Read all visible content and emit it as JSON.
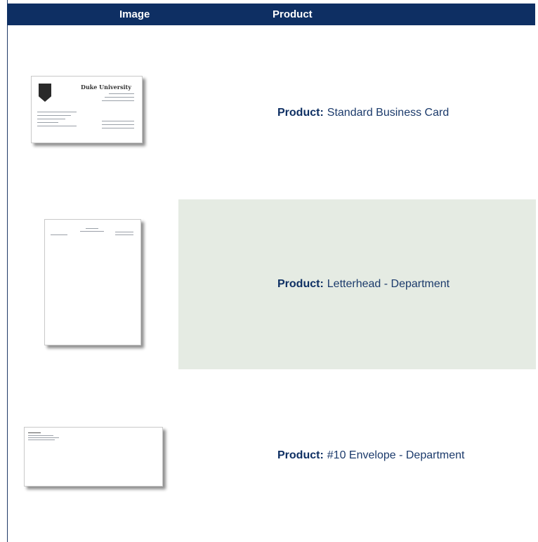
{
  "header": {
    "image_label": "Image",
    "product_label": "Product"
  },
  "rows": [
    {
      "product_prefix": "Product:",
      "product_name": "Standard Business Card",
      "thumbnail": {
        "kind": "business-card",
        "logo_text": "Duke University"
      }
    },
    {
      "product_prefix": "Product:",
      "product_name": "Letterhead - Department",
      "thumbnail": {
        "kind": "letterhead"
      }
    },
    {
      "product_prefix": "Product:",
      "product_name": "#10 Envelope - Department",
      "thumbnail": {
        "kind": "envelope"
      }
    }
  ],
  "colors": {
    "header_bg": "#0e2f63",
    "alt_row_bg": "#e5ebe3",
    "text": "#1b3a6b"
  }
}
